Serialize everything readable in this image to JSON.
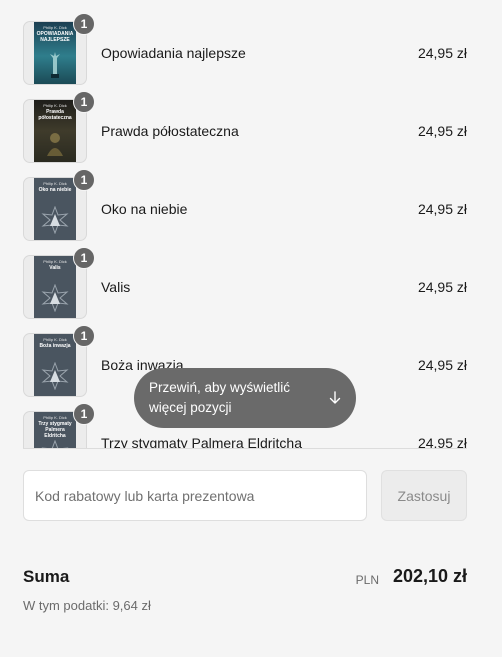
{
  "cart": {
    "items": [
      {
        "title": "Opowiadania najlepsze",
        "price": "24,95 zł",
        "quantity": "1",
        "cover_author": "Philip K. Dick",
        "cover_title": "OPOWIADANIA NAJLEPSZE",
        "cover_color": "#2f6f7a"
      },
      {
        "title": "Prawda półostateczna",
        "price": "24,95 zł",
        "quantity": "1",
        "cover_author": "Philip K. Dick",
        "cover_title": "Prawda półostateczna",
        "cover_color": "#3e3a2c"
      },
      {
        "title": "Oko na niebie",
        "price": "24,95 zł",
        "quantity": "1",
        "cover_author": "Philip K. Dick",
        "cover_title": "Oko na niebie",
        "cover_color": "#4a5560"
      },
      {
        "title": "Valis",
        "price": "24,95 zł",
        "quantity": "1",
        "cover_author": "Philip K. Dick",
        "cover_title": "Valis",
        "cover_color": "#4a5560"
      },
      {
        "title": "Boża inwazja",
        "price": "24,95 zł",
        "quantity": "1",
        "cover_author": "Philip K. Dick",
        "cover_title": "Boża inwazja",
        "cover_color": "#4a5560"
      },
      {
        "title": "Trzy stygmaty Palmera Eldritcha",
        "price": "24,95 zł",
        "quantity": "1",
        "cover_author": "Philip K. Dick",
        "cover_title": "Trzy stygmaty Palmera Eldritcha",
        "cover_color": "#4a5560"
      }
    ],
    "scroll_hint": {
      "line1": "Przewiń, aby wyświetlić",
      "line2": "więcej pozycji",
      "icon": "arrow-down-icon"
    }
  },
  "discount": {
    "placeholder": "Kod rabatowy lub karta prezentowa",
    "value": "",
    "apply_label": "Zastosuj"
  },
  "summary": {
    "total_label": "Suma",
    "currency": "PLN",
    "total_amount": "202,10 zł",
    "tax_line": "W tym podatki: 9,64 zł"
  },
  "colors": {
    "background": "#f5f5f5",
    "badge": "#666666",
    "scroll_hint_bg": "#6a6a6a",
    "apply_button_bg": "#ececec"
  }
}
